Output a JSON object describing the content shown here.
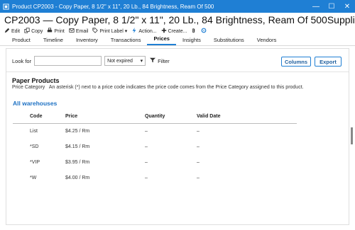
{
  "window": {
    "title": "Product CP2003 - Copy Paper, 8 1/2\" x 11\", 20 Lb., 84 Brightness, Ream Of 500",
    "minimize": "—",
    "maximize": "☐",
    "close": "✕",
    "accent": "#1f7fd4"
  },
  "header": {
    "title": "CP2003 — Copy Paper, 8 1/2\" x 11\", 20 Lb., 84 Brightness, Ream Of 500",
    "category": "Supplies"
  },
  "toolbar": {
    "edit": "Edit",
    "copy": "Copy",
    "print": "Print",
    "email": "Email",
    "print_label": "Print Label",
    "action": "Action...",
    "create": "Create..."
  },
  "tabs": [
    "Product",
    "Timeline",
    "Inventory",
    "Transactions",
    "Prices",
    "Insights",
    "Substitutions",
    "Vendors"
  ],
  "active_tab": "Prices",
  "filters": {
    "look_for_label": "Look for",
    "look_for_value": "",
    "status_value": "Not expired",
    "filter_label": "Filter",
    "columns_button": "Columns",
    "export_button": "Export"
  },
  "price_category": {
    "title": "Paper Products",
    "label": "Price Category",
    "note": "An asterisk (*) next to a price code indicates the price code comes from the Price Category assigned to this product."
  },
  "warehouse_title": "All warehouses",
  "columns": {
    "code": "Code",
    "price": "Price",
    "quantity": "Quantity",
    "valid_date": "Valid Date"
  },
  "rows": [
    {
      "code": "List",
      "price": "$4.25 / Rm",
      "quantity": "–",
      "valid_date": "–"
    },
    {
      "code": "*SD",
      "price": "$4.15 / Rm",
      "quantity": "–",
      "valid_date": "–"
    },
    {
      "code": "*VIP",
      "price": "$3.95 / Rm",
      "quantity": "–",
      "valid_date": "–"
    },
    {
      "code": "*W",
      "price": "$4.00 / Rm",
      "quantity": "–",
      "valid_date": "–"
    }
  ]
}
